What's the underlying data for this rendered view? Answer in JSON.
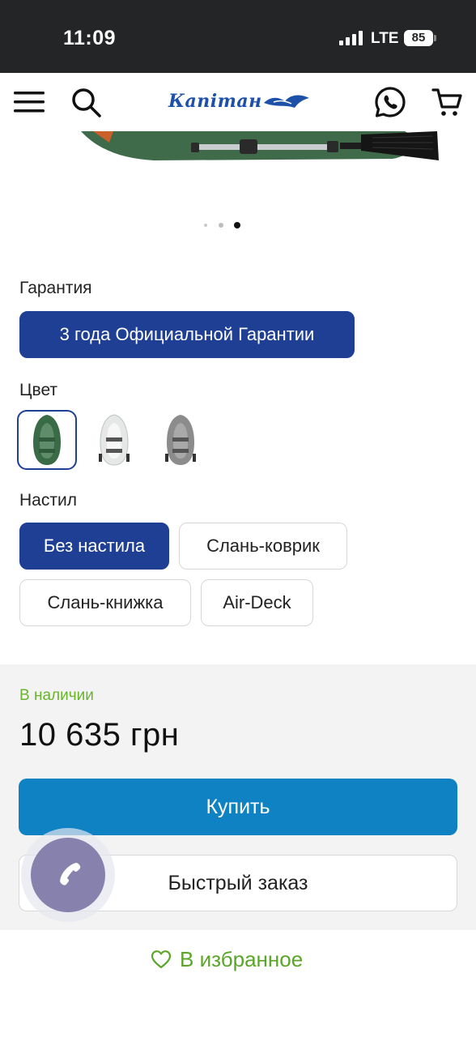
{
  "status_bar": {
    "time": "11:09",
    "network": "LTE",
    "battery": "85"
  },
  "header": {
    "logo_text": "Капітан",
    "icons": [
      "menu-icon",
      "search-icon",
      "viber-phone-icon",
      "cart-icon"
    ]
  },
  "gallery": {
    "slides_total": 3,
    "active_slide": 3
  },
  "warranty": {
    "label": "Гарантия",
    "option": "3 года Официальной Гарантии"
  },
  "color": {
    "label": "Цвет",
    "swatches": [
      "green",
      "white",
      "grey"
    ],
    "selected": "green",
    "colors": {
      "green": "#3a6b47",
      "white": "#e6e8e8",
      "grey": "#8c8c8c"
    }
  },
  "floor": {
    "label": "Настил",
    "options": [
      "Без настила",
      "Слань-коврик",
      "Слань-книжка",
      "Air-Deck"
    ],
    "selected": "Без настила"
  },
  "purchase": {
    "stock": "В наличии",
    "price": "10 635 грн",
    "buy_label": "Купить",
    "quick_order_label": "Быстрый заказ",
    "favorite_label": "В избранное"
  },
  "theme": {
    "accent_blue": "#1f3f94",
    "buy_blue": "#0f82c4",
    "green_text": "#6ab42d",
    "fab": "#8682ad"
  }
}
